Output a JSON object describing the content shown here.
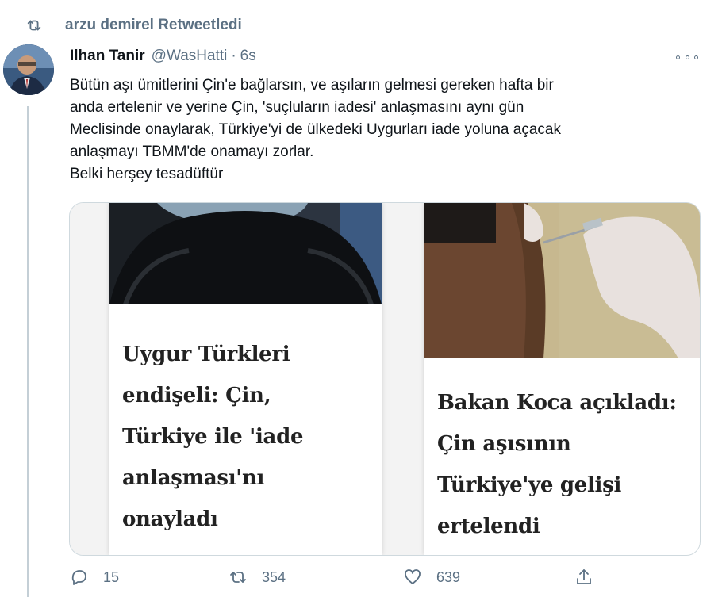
{
  "retweet": {
    "text": "arzu demirel Retweetledi"
  },
  "author": {
    "name": "Ilhan Tanir",
    "handle": "@WasHatti",
    "separator": "·",
    "time": "6s"
  },
  "tweet": {
    "lines": [
      "Bütün aşı ümitlerini Çin'e bağlarsın, ve aşıların gelmesi gereken hafta bir",
      "anda ertelenir ve yerine Çin, 'suçluların iadesi' anlaşmasını aynı gün",
      "Meclisinde onaylarak, Türkiye'yi de ülkedeki Uygurları iade yoluna açacak",
      "anlaşmayı TBMM'de onamayı zorlar.",
      "Belki herşey tesadüftür"
    ]
  },
  "media": {
    "left_headline": [
      "Uygur Türkleri",
      "endişeli: Çin,",
      "Türkiye ile 'iade",
      "anlaşması'nı",
      "onayladı"
    ],
    "right_headline": [
      "Bakan Koca açıkladı:",
      "Çin aşısının",
      "Türkiye'ye gelişi",
      "ertelendi"
    ]
  },
  "actions": {
    "reply_count": "15",
    "retweet_count": "354",
    "like_count": "639"
  },
  "colors": {
    "muted": "#5b7083",
    "text": "#0f1419",
    "border": "#cfd9de"
  }
}
